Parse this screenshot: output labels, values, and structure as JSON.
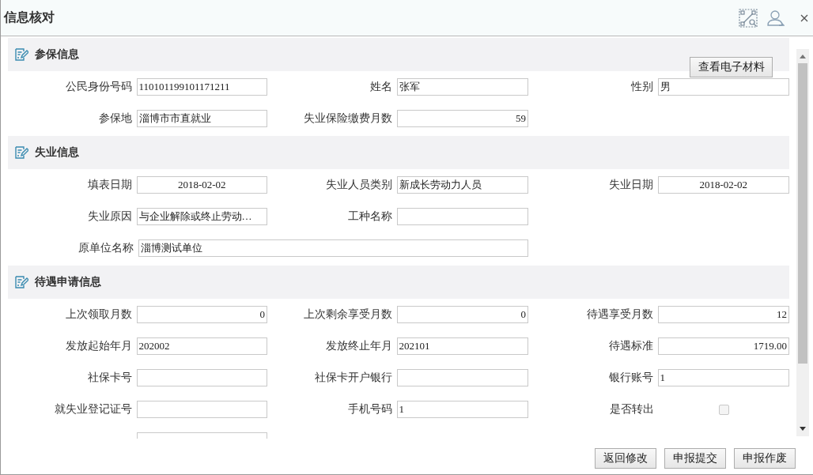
{
  "window": {
    "title": "信息核对"
  },
  "sections": [
    {
      "title": "参保信息",
      "button": "查看电子材料",
      "rows": [
        [
          {
            "kind": "text",
            "label": "公民身份号码",
            "value": "110101199101171211"
          },
          {
            "kind": "text",
            "label": "姓名",
            "value": "张军"
          },
          {
            "kind": "text",
            "label": "性别",
            "value": "男"
          }
        ],
        [
          {
            "kind": "text",
            "label": "参保地",
            "value": "淄博市市直就业"
          },
          {
            "kind": "number",
            "label": "失业保险缴费月数",
            "value": "59"
          }
        ]
      ]
    },
    {
      "title": "失业信息",
      "rows": [
        [
          {
            "kind": "date",
            "label": "填表日期",
            "value": "2018-02-02"
          },
          {
            "kind": "text",
            "label": "失业人员类别",
            "value": "新成长劳动力人员"
          },
          {
            "kind": "date",
            "label": "失业日期",
            "value": "2018-02-02"
          }
        ],
        [
          {
            "kind": "text",
            "label": "失业原因",
            "value": "与企业解除或终止劳动…"
          },
          {
            "kind": "text",
            "label": "工种名称"
          }
        ],
        [
          {
            "kind": "text",
            "label": "原单位名称",
            "value": "淄博测试单位",
            "wide": true
          }
        ]
      ]
    },
    {
      "title": "待遇申请信息",
      "rows": [
        [
          {
            "kind": "number",
            "label": "上次领取月数",
            "value": "0"
          },
          {
            "kind": "number",
            "label": "上次剩余享受月数",
            "value": "0"
          },
          {
            "kind": "number",
            "label": "待遇享受月数",
            "value": "12"
          }
        ],
        [
          {
            "kind": "text",
            "label": "发放起始年月",
            "value": "202002"
          },
          {
            "kind": "text",
            "label": "发放终止年月",
            "value": "202101"
          },
          {
            "kind": "number",
            "label": "待遇标准",
            "value": "1719.00"
          }
        ],
        [
          {
            "kind": "text",
            "label": "社保卡号"
          },
          {
            "kind": "text",
            "label": "社保卡开户银行"
          },
          {
            "kind": "text",
            "label": "银行账号",
            "value": "1"
          }
        ],
        [
          {
            "kind": "text",
            "label": "就失业登记证号"
          },
          {
            "kind": "text",
            "label": "手机号码",
            "value": "1"
          },
          {
            "kind": "checkbox",
            "label": "是否转出",
            "checked": false
          }
        ],
        [
          {
            "kind": "text"
          }
        ]
      ]
    }
  ],
  "buttons": [
    "返回修改",
    "申报提交",
    "申报作废"
  ]
}
